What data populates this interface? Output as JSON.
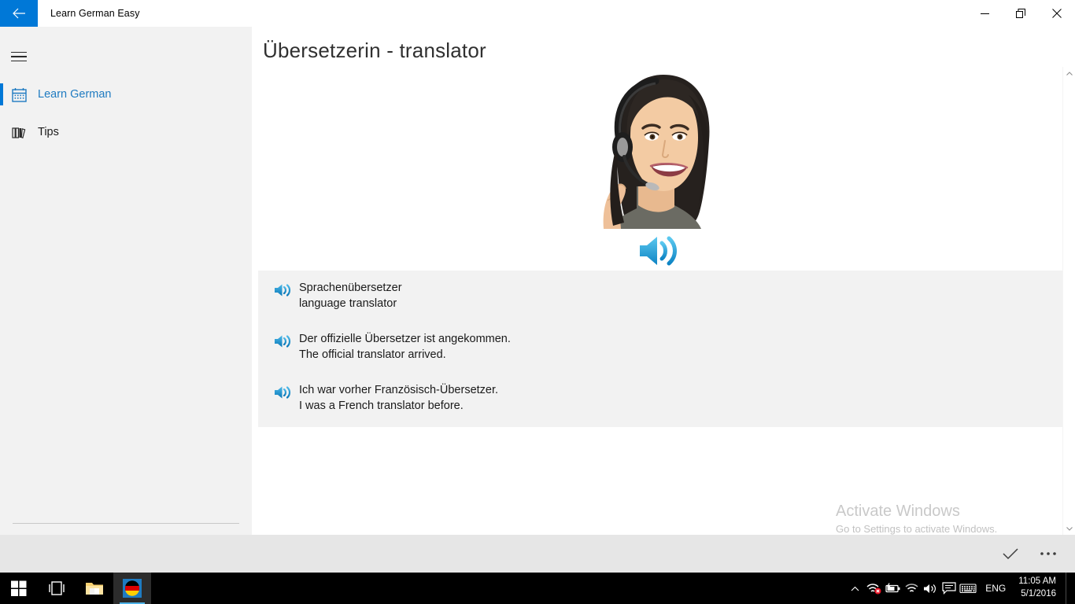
{
  "titlebar": {
    "back_icon": "back-arrow-icon",
    "app_title": "Learn German Easy",
    "minimize_label": "─",
    "maximize_icon": "restore-icon",
    "close_label": "✕",
    "accent_color": "#0078d7"
  },
  "sidebar": {
    "menu_icon": "hamburger-icon",
    "items": [
      {
        "label": "Learn German",
        "icon": "calendar-grid-icon",
        "selected": true
      },
      {
        "label": "Tips",
        "icon": "books-icon",
        "selected": false
      }
    ],
    "selected_color": "#1f7bc1",
    "background": "#f2f2f2"
  },
  "content": {
    "page_title": "Übersetzerin - translator",
    "hero": {
      "image_alt": "woman-with-headset-photo",
      "play_icon": "speaker-icon"
    },
    "phrases": [
      {
        "icon": "speaker-icon",
        "german": "Sprachenübersetzer",
        "english": "language translator"
      },
      {
        "icon": "speaker-icon",
        "german": "Der offizielle Übersetzer ist angekommen.",
        "english": "The official translator arrived."
      },
      {
        "icon": "speaker-icon",
        "german": "Ich war vorher Französisch-Übersetzer.",
        "english": "I was a French translator before."
      }
    ],
    "scrollbar": {
      "up_arrow": "chevron-up-icon",
      "down_arrow": "chevron-down-icon"
    }
  },
  "watermark": {
    "title": "Activate Windows",
    "subtitle": "Go to Settings to activate Windows."
  },
  "appbar": {
    "accept_icon": "checkmark-icon",
    "more_icon": "ellipsis-icon"
  },
  "taskbar": {
    "start_icon": "windows-start-icon",
    "taskview_icon": "task-view-icon",
    "explorer_icon": "file-explorer-icon",
    "app_icon": "german-flag-app-icon",
    "tray": [
      {
        "icon": "chevron-up-icon",
        "name": "show-hidden-icons"
      },
      {
        "icon": "network-error-icon",
        "name": "network-problem"
      },
      {
        "icon": "battery-icon",
        "name": "battery-status"
      },
      {
        "icon": "wifi-icon",
        "name": "wireless-network"
      },
      {
        "icon": "volume-icon",
        "name": "speakers-volume"
      },
      {
        "icon": "action-center-icon",
        "name": "action-center"
      },
      {
        "icon": "keyboard-icon",
        "name": "touch-keyboard"
      }
    ],
    "language": "ENG",
    "time": "11:05 AM",
    "date": "5/1/2016"
  }
}
